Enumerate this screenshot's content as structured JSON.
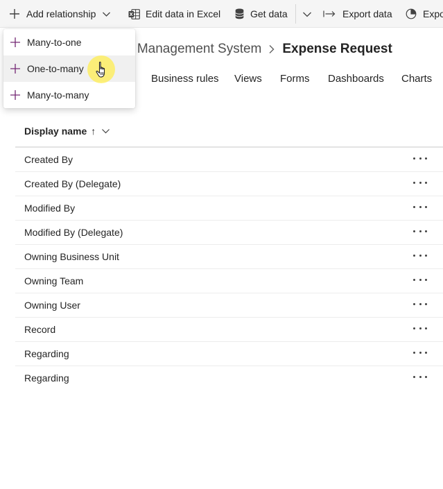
{
  "toolbar": {
    "add_relationship": "Add relationship",
    "edit_data_in_excel": "Edit data in Excel",
    "get_data": "Get data",
    "export_data": "Export data",
    "export_partial": "Expo"
  },
  "breadcrumb": {
    "parent": "e Management System",
    "current": "Expense Request"
  },
  "tabs": [
    "Business rules",
    "Views",
    "Forms",
    "Dashboards",
    "Charts"
  ],
  "grid": {
    "column_header": "Display name",
    "sort_indicator": "↑",
    "rows": [
      "Created By",
      "Created By (Delegate)",
      "Modified By",
      "Modified By (Delegate)",
      "Owning Business Unit",
      "Owning Team",
      "Owning User",
      "Record",
      "Regarding",
      "Regarding"
    ]
  },
  "menu": {
    "items": [
      "Many-to-one",
      "One-to-many",
      "Many-to-many"
    ],
    "hovered_index": 1
  },
  "colors": {
    "accent_purple": "#742774",
    "excel_green": "#5b5b5b",
    "cursor_highlight": "#ffee50"
  }
}
